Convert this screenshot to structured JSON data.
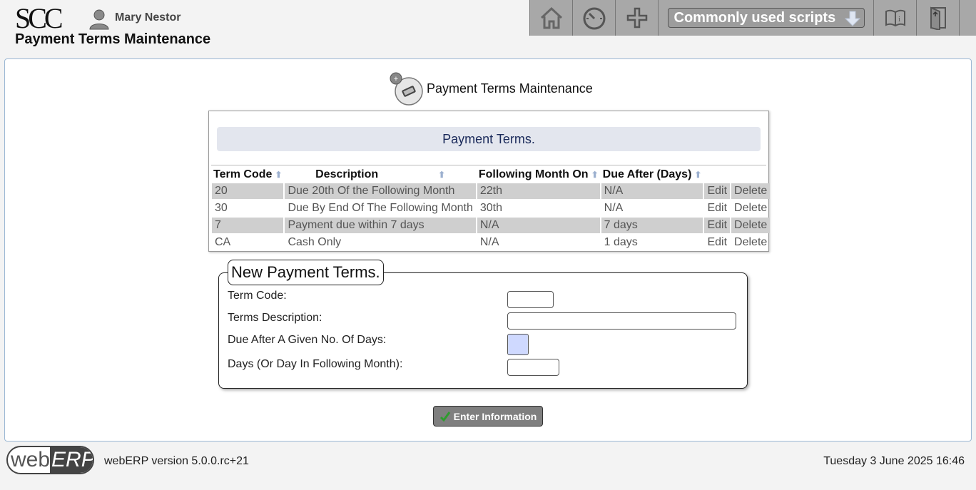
{
  "header": {
    "logo_text": "SCC",
    "user_name": "Mary Nestor",
    "page_title": "Payment Terms Maintenance",
    "scripts_menu_label": "Commonly used scripts"
  },
  "main": {
    "section_title": "Payment Terms Maintenance",
    "table_caption": "Payment Terms.",
    "columns": [
      "Term Code",
      "Description",
      "Following Month On",
      "Due After (Days)"
    ],
    "rows": [
      {
        "code": "20",
        "description": "Due 20th Of the Following Month",
        "following": "22th",
        "due": "N/A",
        "edit": "Edit",
        "delete": "Delete"
      },
      {
        "code": "30",
        "description": "Due By End Of The Following Month",
        "following": "30th",
        "due": "N/A",
        "edit": "Edit",
        "delete": "Delete"
      },
      {
        "code": "7",
        "description": "Payment due within 7 days",
        "following": "N/A",
        "due": "7 days",
        "edit": "Edit",
        "delete": "Delete"
      },
      {
        "code": "CA",
        "description": "Cash Only",
        "following": "N/A",
        "due": "1 days",
        "edit": "Edit",
        "delete": "Delete"
      }
    ]
  },
  "form": {
    "legend": "New Payment Terms.",
    "term_code_label": "Term Code:",
    "term_code_value": "",
    "description_label": "Terms Description:",
    "description_value": "",
    "due_after_label": "Due After A Given No. Of Days:",
    "days_label": "Days (Or Day In Following Month):",
    "days_value": "",
    "submit_label": "Enter Information"
  },
  "footer": {
    "logo_web": "web",
    "logo_erp": "ERP",
    "version": "webERP version 5.0.0.rc+21",
    "datetime": "Tuesday 3 June 2025 16:46"
  },
  "colors": {
    "toolbar": "#a8a8a8",
    "caption_bg": "#e3e6ee",
    "odd_row": "#cfcfcf",
    "checkbox_fill": "#cfd9ff",
    "panel_border": "#9cb8d4"
  }
}
